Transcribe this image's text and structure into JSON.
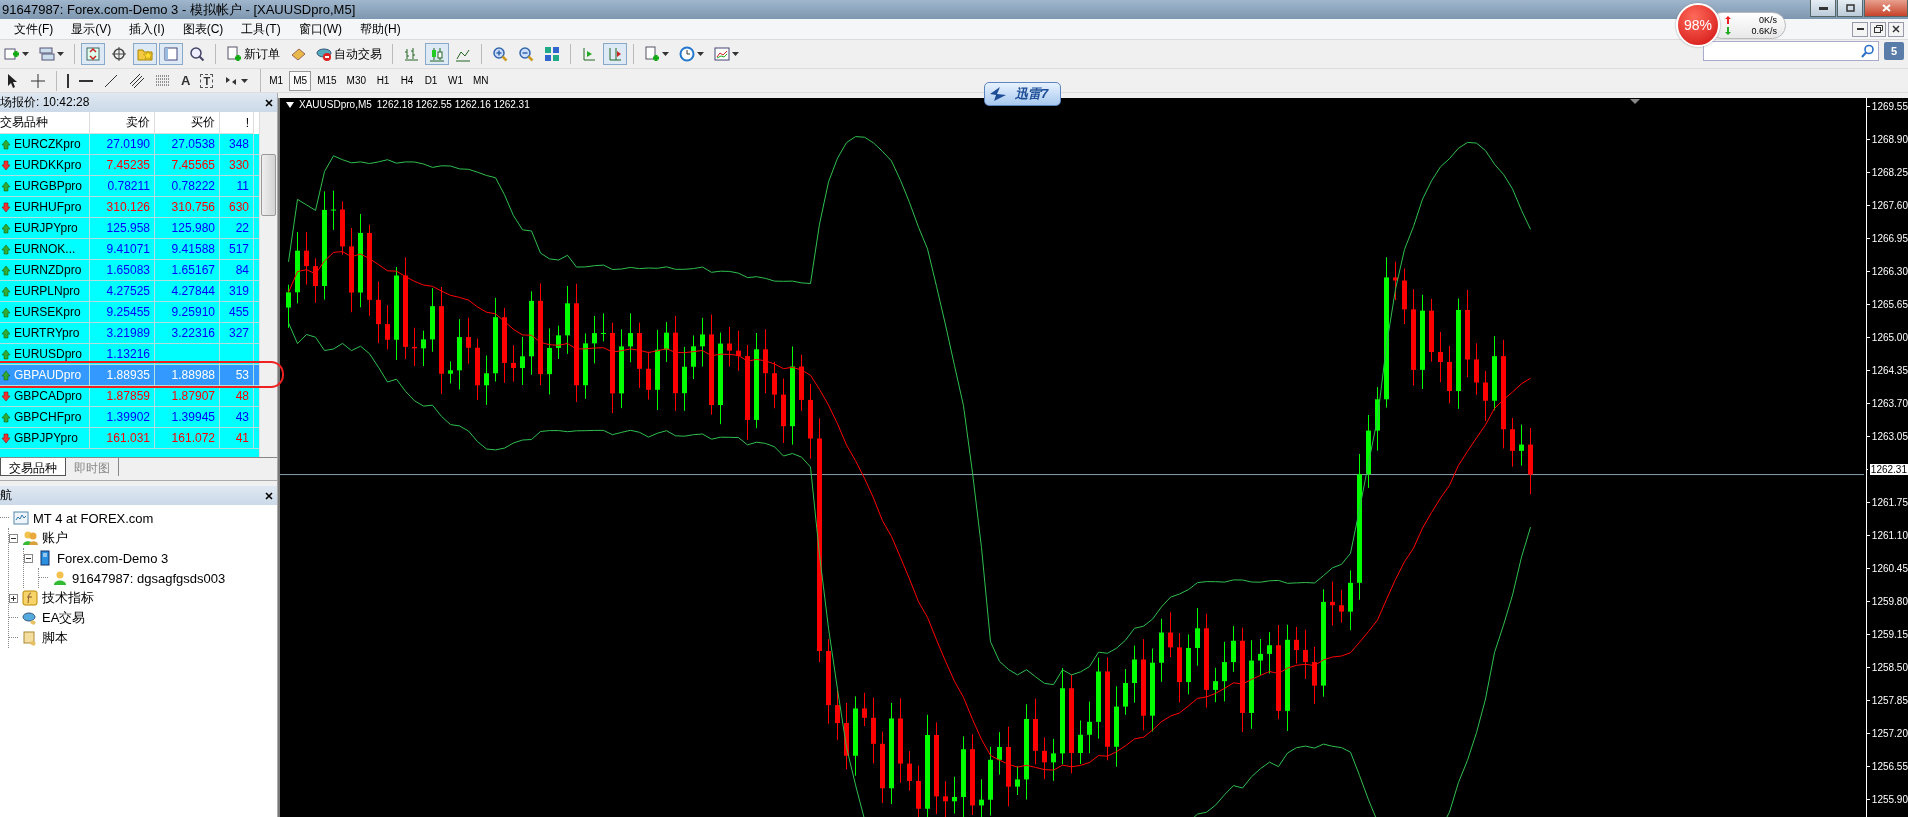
{
  "window": {
    "title": "91647987: Forex.com-Demo 3 - 模拟帐户 - [XAUUSDpro,M5]"
  },
  "menu": [
    "文件(F)",
    "显示(V)",
    "插入(I)",
    "图表(C)",
    "工具(T)",
    "窗口(W)",
    "帮助(H)"
  ],
  "toolbar": [
    {
      "kind": "new-chart",
      "pressed": false,
      "dropdown": true
    },
    {
      "kind": "profiles",
      "pressed": false,
      "dropdown": true
    },
    {
      "kind": "separator"
    },
    {
      "kind": "market-watch",
      "pressed": true
    },
    {
      "kind": "data-window",
      "pressed": false
    },
    {
      "kind": "navigator",
      "pressed": true
    },
    {
      "kind": "terminal",
      "pressed": true
    },
    {
      "kind": "tester",
      "pressed": false
    },
    {
      "kind": "separator"
    },
    {
      "kind": "new-order",
      "label": "新订单",
      "pressed": false
    },
    {
      "kind": "history",
      "pressed": false
    },
    {
      "kind": "auto-trading",
      "label": "自动交易",
      "pressed": false
    },
    {
      "kind": "separator"
    },
    {
      "kind": "bar-chart",
      "pressed": false
    },
    {
      "kind": "candles",
      "pressed": true
    },
    {
      "kind": "line-chart",
      "pressed": false
    },
    {
      "kind": "separator"
    },
    {
      "kind": "zoom-in",
      "pressed": false
    },
    {
      "kind": "zoom-out",
      "pressed": false
    },
    {
      "kind": "tile",
      "pressed": false
    },
    {
      "kind": "separator"
    },
    {
      "kind": "chart-shift",
      "pressed": false
    },
    {
      "kind": "autoscroll",
      "pressed": true
    },
    {
      "kind": "separator"
    },
    {
      "kind": "indicators",
      "pressed": false,
      "dropdown": true
    },
    {
      "kind": "periods",
      "pressed": false,
      "dropdown": true
    },
    {
      "kind": "templates",
      "pressed": false,
      "dropdown": true
    }
  ],
  "drawing_tools": [
    {
      "kind": "cursor"
    },
    {
      "kind": "crosshair"
    },
    {
      "kind": "separator"
    },
    {
      "kind": "vline"
    },
    {
      "kind": "hline"
    },
    {
      "kind": "trendline"
    },
    {
      "kind": "channel"
    },
    {
      "kind": "fibo"
    },
    {
      "kind": "text",
      "label": "A"
    },
    {
      "kind": "label",
      "label": "T"
    },
    {
      "kind": "arrows",
      "dropdown": true
    }
  ],
  "timeframes": [
    {
      "label": "M1",
      "selected": false
    },
    {
      "label": "M5",
      "selected": true
    },
    {
      "label": "M15",
      "selected": false
    },
    {
      "label": "M30",
      "selected": false
    },
    {
      "label": "H1",
      "selected": false
    },
    {
      "label": "H4",
      "selected": false
    },
    {
      "label": "D1",
      "selected": false
    },
    {
      "label": "W1",
      "selected": false
    },
    {
      "label": "MN",
      "selected": false
    }
  ],
  "speed_widget": {
    "percent": "98%",
    "upload": "0K/s",
    "download": "0.6K/s"
  },
  "download_badge": "迅雷7",
  "message_count": "5",
  "market_watch": {
    "title": "场报价: 10:42:28",
    "columns": [
      "交易品种",
      "卖价",
      "买价",
      "!"
    ],
    "rows": [
      {
        "symbol": "EURCZKpro",
        "bid": "27.0190",
        "ask": "27.0538",
        "spread": "348",
        "rising": true,
        "selected": false
      },
      {
        "symbol": "EURDKKpro",
        "bid": "7.45235",
        "ask": "7.45565",
        "spread": "330",
        "rising": false,
        "selected": false
      },
      {
        "symbol": "EURGBPpro",
        "bid": "0.78211",
        "ask": "0.78222",
        "spread": "11",
        "rising": true,
        "selected": false
      },
      {
        "symbol": "EURHUFpro",
        "bid": "310.126",
        "ask": "310.756",
        "spread": "630",
        "rising": false,
        "selected": false
      },
      {
        "symbol": "EURJPYpro",
        "bid": "125.958",
        "ask": "125.980",
        "spread": "22",
        "rising": true,
        "selected": false
      },
      {
        "symbol": "EURNOK...",
        "bid": "9.41071",
        "ask": "9.41588",
        "spread": "517",
        "rising": true,
        "selected": false
      },
      {
        "symbol": "EURNZDpro",
        "bid": "1.65083",
        "ask": "1.65167",
        "spread": "84",
        "rising": true,
        "selected": false
      },
      {
        "symbol": "EURPLNpro",
        "bid": "4.27525",
        "ask": "4.27844",
        "spread": "319",
        "rising": true,
        "selected": false
      },
      {
        "symbol": "EURSEKpro",
        "bid": "9.25455",
        "ask": "9.25910",
        "spread": "455",
        "rising": true,
        "selected": false
      },
      {
        "symbol": "EURTRYpro",
        "bid": "3.21989",
        "ask": "3.22316",
        "spread": "327",
        "rising": true,
        "selected": false
      },
      {
        "symbol": "EURUSDpro",
        "bid": "1.13216",
        "rising": true,
        "selected": false
      },
      {
        "symbol": "GBPAUDpro",
        "bid": "1.88935",
        "ask": "1.88988",
        "spread": "53",
        "rising": true,
        "selected": true
      },
      {
        "symbol": "GBPCADpro",
        "bid": "1.87859",
        "ask": "1.87907",
        "spread": "48",
        "rising": false,
        "selected": false
      },
      {
        "symbol": "GBPCHFpro",
        "bid": "1.39902",
        "ask": "1.39945",
        "spread": "43",
        "rising": true,
        "selected": false
      },
      {
        "symbol": "GBPJPYpro",
        "bid": "161.031",
        "ask": "161.072",
        "spread": "41",
        "rising": false,
        "selected": false
      }
    ],
    "tabs": [
      {
        "label": "交易品种",
        "selected": true
      },
      {
        "label": "即时图",
        "selected": false
      }
    ]
  },
  "navigator": {
    "title": "航",
    "tree": [
      {
        "label": "MT 4 at FOREX.com",
        "kind": "terminal",
        "children": [
          {
            "label": "账户",
            "kind": "accounts",
            "expanded": true,
            "children": [
              {
                "label": "Forex.com-Demo 3",
                "kind": "server",
                "expanded": true,
                "children": [
                  {
                    "label": "91647987: dgsagfgsds003",
                    "kind": "user"
                  }
                ]
              }
            ]
          },
          {
            "label": "技术指标",
            "kind": "indicators",
            "expanded": false
          },
          {
            "label": "EA交易",
            "kind": "experts"
          },
          {
            "label": "脚本",
            "kind": "scripts"
          }
        ]
      }
    ]
  },
  "chart": {
    "symbol": "XAUUSDpro,M5",
    "ohlc": "1262.18 1262.55 1262.16 1262.31",
    "price_scale": [
      {
        "text": "1269.55",
        "kind": "tick"
      },
      {
        "text": "1268.90",
        "kind": "tick"
      },
      {
        "text": "1268.25",
        "kind": "tick"
      },
      {
        "text": "1267.60",
        "kind": "tick"
      },
      {
        "text": "1266.95",
        "kind": "tick"
      },
      {
        "text": "1266.30",
        "kind": "tick"
      },
      {
        "text": "1265.65",
        "kind": "tick"
      },
      {
        "text": "1265.00",
        "kind": "tick"
      },
      {
        "text": "1264.35",
        "kind": "tick"
      },
      {
        "text": "1263.70",
        "kind": "tick"
      },
      {
        "text": "1263.05",
        "kind": "tick"
      },
      {
        "text": "1262.31",
        "kind": "current"
      },
      {
        "text": "1261.75",
        "kind": "tick"
      },
      {
        "text": "1261.10",
        "kind": "tick"
      },
      {
        "text": "1260.45",
        "kind": "tick"
      },
      {
        "text": "1259.80",
        "kind": "tick"
      },
      {
        "text": "1259.15",
        "kind": "tick"
      },
      {
        "text": "1258.50",
        "kind": "tick"
      },
      {
        "text": "1257.85",
        "kind": "tick"
      },
      {
        "text": "1257.20",
        "kind": "tick"
      },
      {
        "text": "1256.55",
        "kind": "tick"
      },
      {
        "text": "1255.90",
        "kind": "tick"
      }
    ]
  }
}
